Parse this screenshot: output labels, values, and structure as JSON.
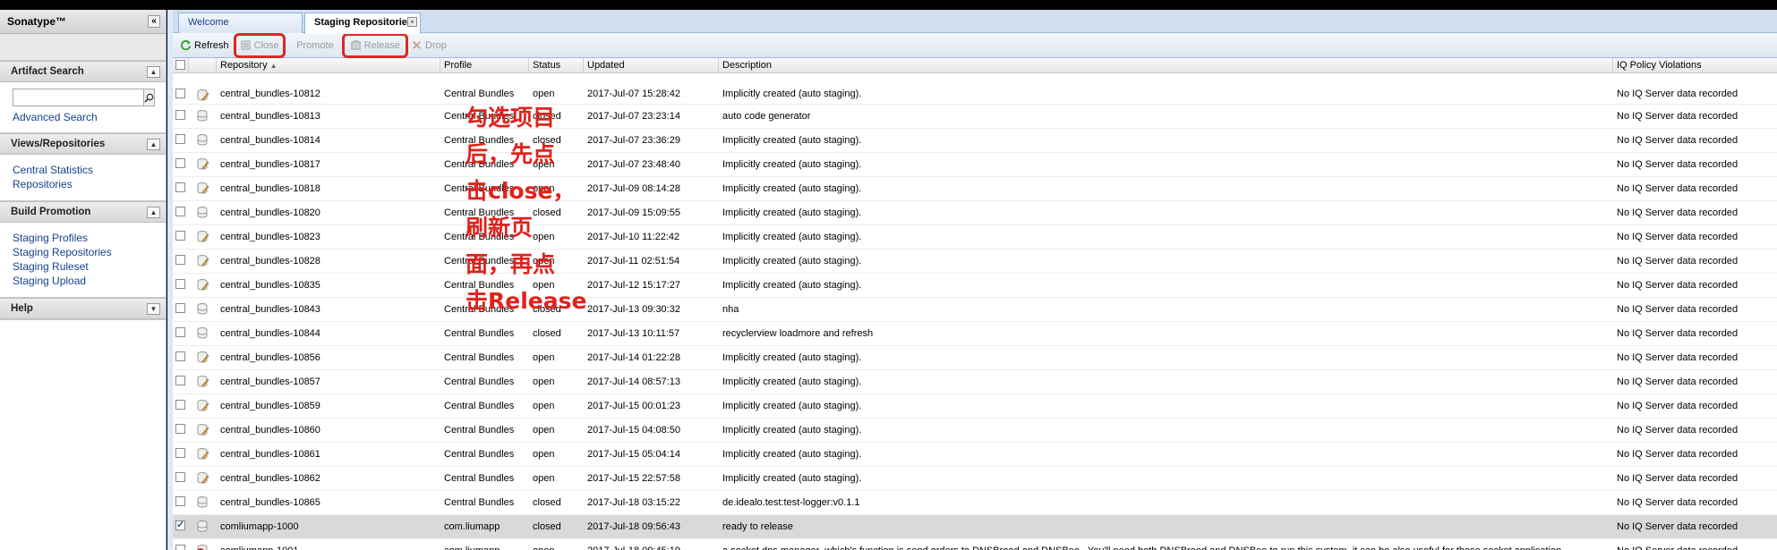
{
  "app": {
    "title": "Sonatype™"
  },
  "sidebar": {
    "artifact_search": {
      "header": "Artifact Search",
      "search_value": "",
      "advanced_link": "Advanced Search"
    },
    "views": {
      "header": "Views/Repositories",
      "links": [
        "Central Statistics",
        "Repositories"
      ]
    },
    "build_promotion": {
      "header": "Build Promotion",
      "links": [
        "Staging Profiles",
        "Staging Repositories",
        "Staging Ruleset",
        "Staging Upload"
      ]
    },
    "help": {
      "header": "Help"
    }
  },
  "tabs": {
    "welcome": "Welcome",
    "staging": "Staging Repositories"
  },
  "toolbar": {
    "refresh": "Refresh",
    "close": "Close",
    "promote": "Promote",
    "release": "Release",
    "drop": "Drop"
  },
  "columns": {
    "repository": "Repository",
    "profile": "Profile",
    "status": "Status",
    "updated": "Updated",
    "description": "Description",
    "iq": "IQ Policy Violations"
  },
  "annotation": "勾选项目\n后，先点\n击close，\n刷新页\n面，再点\n击Release",
  "rows": [
    {
      "repo": "central_bundles-10812",
      "profile": "Central Bundles",
      "status": "open",
      "updated": "2017-Jul-07 15:28:42",
      "desc": "Implicitly created (auto staging).",
      "iq": "No IQ Server data recorded",
      "icon": "edit",
      "checked": false
    },
    {
      "repo": "central_bundles-10813",
      "profile": "Central Bundles",
      "status": "closed",
      "updated": "2017-Jul-07 23:23:14",
      "desc": "auto code generator",
      "iq": "No IQ Server data recorded",
      "icon": "closed",
      "checked": false
    },
    {
      "repo": "central_bundles-10814",
      "profile": "Central Bundles",
      "status": "closed",
      "updated": "2017-Jul-07 23:36:29",
      "desc": "Implicitly created (auto staging).",
      "iq": "No IQ Server data recorded",
      "icon": "closed",
      "checked": false
    },
    {
      "repo": "central_bundles-10817",
      "profile": "Central Bundles",
      "status": "open",
      "updated": "2017-Jul-07 23:48:40",
      "desc": "Implicitly created (auto staging).",
      "iq": "No IQ Server data recorded",
      "icon": "edit",
      "checked": false
    },
    {
      "repo": "central_bundles-10818",
      "profile": "Central Bundles",
      "status": "open",
      "updated": "2017-Jul-09 08:14:28",
      "desc": "Implicitly created (auto staging).",
      "iq": "No IQ Server data recorded",
      "icon": "edit",
      "checked": false
    },
    {
      "repo": "central_bundles-10820",
      "profile": "Central Bundles",
      "status": "closed",
      "updated": "2017-Jul-09 15:09:55",
      "desc": "Implicitly created (auto staging).",
      "iq": "No IQ Server data recorded",
      "icon": "closed",
      "checked": false
    },
    {
      "repo": "central_bundles-10823",
      "profile": "Central Bundles",
      "status": "open",
      "updated": "2017-Jul-10 11:22:42",
      "desc": "Implicitly created (auto staging).",
      "iq": "No IQ Server data recorded",
      "icon": "edit",
      "checked": false
    },
    {
      "repo": "central_bundles-10828",
      "profile": "Central Bundles",
      "status": "open",
      "updated": "2017-Jul-11 02:51:54",
      "desc": "Implicitly created (auto staging).",
      "iq": "No IQ Server data recorded",
      "icon": "edit",
      "checked": false
    },
    {
      "repo": "central_bundles-10835",
      "profile": "Central Bundles",
      "status": "open",
      "updated": "2017-Jul-12 15:17:27",
      "desc": "Implicitly created (auto staging).",
      "iq": "No IQ Server data recorded",
      "icon": "edit",
      "checked": false
    },
    {
      "repo": "central_bundles-10843",
      "profile": "Central Bundles",
      "status": "closed",
      "updated": "2017-Jul-13 09:30:32",
      "desc": "nha",
      "iq": "No IQ Server data recorded",
      "icon": "closed",
      "checked": false
    },
    {
      "repo": "central_bundles-10844",
      "profile": "Central Bundles",
      "status": "closed",
      "updated": "2017-Jul-13 10:11:57",
      "desc": "recyclerview loadmore and refresh",
      "iq": "No IQ Server data recorded",
      "icon": "closed",
      "checked": false
    },
    {
      "repo": "central_bundles-10856",
      "profile": "Central Bundles",
      "status": "open",
      "updated": "2017-Jul-14 01:22:28",
      "desc": "Implicitly created (auto staging).",
      "iq": "No IQ Server data recorded",
      "icon": "edit",
      "checked": false
    },
    {
      "repo": "central_bundles-10857",
      "profile": "Central Bundles",
      "status": "open",
      "updated": "2017-Jul-14 08:57:13",
      "desc": "Implicitly created (auto staging).",
      "iq": "No IQ Server data recorded",
      "icon": "edit",
      "checked": false
    },
    {
      "repo": "central_bundles-10859",
      "profile": "Central Bundles",
      "status": "open",
      "updated": "2017-Jul-15 00:01:23",
      "desc": "Implicitly created (auto staging).",
      "iq": "No IQ Server data recorded",
      "icon": "edit",
      "checked": false
    },
    {
      "repo": "central_bundles-10860",
      "profile": "Central Bundles",
      "status": "open",
      "updated": "2017-Jul-15 04:08:50",
      "desc": "Implicitly created (auto staging).",
      "iq": "No IQ Server data recorded",
      "icon": "edit",
      "checked": false
    },
    {
      "repo": "central_bundles-10861",
      "profile": "Central Bundles",
      "status": "open",
      "updated": "2017-Jul-15 05:04:14",
      "desc": "Implicitly created (auto staging).",
      "iq": "No IQ Server data recorded",
      "icon": "edit",
      "checked": false
    },
    {
      "repo": "central_bundles-10862",
      "profile": "Central Bundles",
      "status": "open",
      "updated": "2017-Jul-15 22:57:58",
      "desc": "Implicitly created (auto staging).",
      "iq": "No IQ Server data recorded",
      "icon": "edit",
      "checked": false
    },
    {
      "repo": "central_bundles-10865",
      "profile": "Central Bundles",
      "status": "closed",
      "updated": "2017-Jul-18 03:15:22",
      "desc": "de.idealo.test:test-logger:v0.1.1",
      "iq": "No IQ Server data recorded",
      "icon": "closed",
      "checked": false
    },
    {
      "repo": "comliumapp-1000",
      "profile": "com.liumapp",
      "status": "closed",
      "updated": "2017-Jul-18 09:56:43",
      "desc": "ready to release",
      "iq": "No IQ Server data recorded",
      "icon": "closed",
      "checked": true
    },
    {
      "repo": "comliumapp-1001",
      "profile": "com.liumapp",
      "status": "open",
      "updated": "2017-Jul-18 09:45:19",
      "desc": "a socket dns manager ,which's function is send orders to DNSBrood and DNSBee . You'll need both DNSBrood and DNSBee to run this system. it can be also useful for those socket application.",
      "iq": "No IQ Server data recorded",
      "icon": "error",
      "checked": false
    }
  ]
}
